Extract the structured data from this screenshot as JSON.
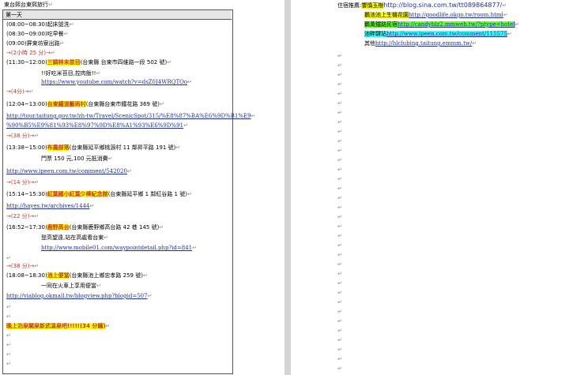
{
  "left": {
    "title": "東台熙台東熙旅行",
    "table_header": "第一天",
    "schedule": [
      {
        "time": "(08:00~08:30)",
        "text": "起床盥洗"
      },
      {
        "time": "(08:30~09:00)",
        "text": "吃早餐"
      },
      {
        "time": "(09:00)",
        "text": "屏東坊寮出路"
      },
      {
        "time": "",
        "text": "→(2小時 25 分)→"
      },
      {
        "time": "(11:30~12:00)",
        "poi": "三調林未苗目",
        "text": "(台東縣 台東市四維路一段 502 號)"
      },
      {
        "time": "",
        "text": "!!好吃米苔目,控肉飯!!"
      },
      {
        "time": "",
        "link": "https://www.youtube.com/watch?v=dsZ0J4WRQTOo"
      },
      {
        "time": "",
        "text": "→(4分)→"
      },
      {
        "time": "(12:04~13:00)",
        "poi": "台東鐵道藝術村",
        "text": "(台東縣台東市鐵花路 369 號)"
      },
      {
        "time": "",
        "link": "http://tour.taitung.gov.tw/zh-tw/Travel/ScenicSpot/315/%E8%87%BA%E6%9D%B1%E9"
      },
      {
        "time": "",
        "link": "%90%B5%E9%81%93%E8%97%9D%E8%A1%93%E6%9D%91"
      },
      {
        "time": "",
        "text": "→(38 分)→"
      },
      {
        "time": "(13:38~15:00)",
        "poi": "布農部落",
        "text": "(台東縣延平鄉桃源村 11 鄰昇平路 191 號)"
      },
      {
        "time": "",
        "text": "門票 150 元,100 元抵消費"
      },
      {
        "time": "",
        "link": "http://www.ipeen.com.tw/comment/542020"
      },
      {
        "time": "",
        "text": "→(14 分)→"
      },
      {
        "time": "(15:14~15:30)",
        "poi": "紅葉國小紅葉少棒紀念館",
        "text": "(台東縣延平鄉 1 鄰紅谷路 1 號)"
      },
      {
        "time": "",
        "link": "http://hayes.tw/archives/1444"
      },
      {
        "time": "",
        "text": "→(22 分)→"
      },
      {
        "time": "(16:52~17:30)",
        "poi": "鹿野高台",
        "text": "(台東縣鹿野鄉高台路 42 巷 145 號)"
      },
      {
        "time": "",
        "text": "登高望遠,站在高處看台東"
      },
      {
        "time": "",
        "link": "http://www.mobile01.com/waypointdetail.php?id=841"
      },
      {
        "time": "",
        "text": ""
      },
      {
        "time": "",
        "text": "→(38 分)→"
      },
      {
        "time": "(18:08~18:30)",
        "poi": "池上便當",
        "text": "(台東縣池上鄉忠孝路 259 號)"
      },
      {
        "time": "",
        "text": "一同在火車上享用便當"
      },
      {
        "time": "",
        "link": "http://viablog.okmall.tw/blogview.php?blogid=507"
      },
      {
        "time": "",
        "text": ""
      },
      {
        "time": "",
        "text": ""
      },
      {
        "time": "",
        "poi": "晚上泊泉關泉新武溫泉吧!!!!!(34 分鐘)",
        "text": ""
      }
    ]
  },
  "right": {
    "label_stay": "住宿推薦:",
    "items": [
      {
        "name": "饗慎玉樹",
        "url": "http://blog.sina.com.tw/tt089864877/",
        "color": "yellow"
      },
      {
        "name": "鵝池池上生機花園",
        "url": "http://goodlife.okgo.tw/room.html",
        "color": "yellow"
      },
      {
        "name": "鵝黃鐵路民宿",
        "url": "http://candyblz2.mmweb.tw/?ptype=hotel",
        "color": "green"
      },
      {
        "name": "池畔驛站",
        "url": "http://www.ipeen.com.tw/comment/115575",
        "color": "cyan"
      },
      {
        "name": "其他",
        "url": "http://hlclubing.taitung.emmm.tw/",
        "color": "none"
      }
    ]
  },
  "colors": {
    "highlight_yellow": "#ffff00",
    "highlight_green": "#66ff33",
    "highlight_cyan": "#33ffff",
    "poi_red": "#c0392b",
    "link_blue": "#1f2fa8"
  },
  "icons": {
    "paragraph_mark": "↵"
  }
}
